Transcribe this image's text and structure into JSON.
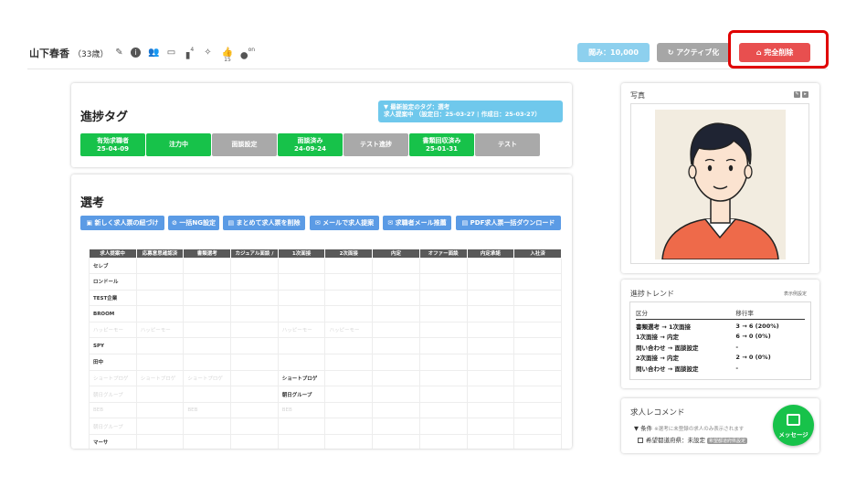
{
  "header": {
    "name": "山下春香",
    "age": "（33歳）",
    "icon_counts": {
      "doc": "4",
      "like": "15",
      "person": "on"
    },
    "view_button": "閲み：10,000",
    "active_button": "アクティブ化",
    "delete_button": "完全削除"
  },
  "progress_tags": {
    "title": "進捗タグ",
    "info_line1": "最新設定のタグ：選考",
    "info_line2": "求人提案中 （設定日：25-03-27 | 作成日：25-03-27）",
    "tags": [
      {
        "label": "有効求職者",
        "date": "25-04-09",
        "color": "green"
      },
      {
        "label": "注力中",
        "date": "",
        "color": "green"
      },
      {
        "label": "面談設定",
        "date": "",
        "color": "gray"
      },
      {
        "label": "面談済み",
        "date": "24-09-24",
        "color": "green"
      },
      {
        "label": "テスト進捗",
        "date": "",
        "color": "gray"
      },
      {
        "label": "書類回収済み",
        "date": "25-01-31",
        "color": "green"
      },
      {
        "label": "テスト",
        "date": "",
        "color": "gray"
      }
    ]
  },
  "selection": {
    "title": "選考",
    "actions": [
      "新しく求人票の紐づけ",
      "一括NG設定",
      "まとめて求人票を削除",
      "メールで求人提案",
      "求職者メール推薦",
      "PDF求人票一括ダウンロード"
    ],
    "columns": [
      "求人提案中",
      "応募意思確認済",
      "書類選考",
      "カジュアル面談 /",
      "1次面接",
      "2次面接",
      "内定",
      "オファー面談",
      "内定承諾",
      "入社済"
    ],
    "rows": [
      {
        "cells": [
          "セレブ",
          "",
          "",
          "",
          "",
          "",
          "",
          "",
          "",
          ""
        ],
        "faint": false
      },
      {
        "cells": [
          "ロンドール",
          "",
          "",
          "",
          "",
          "",
          "",
          "",
          "",
          ""
        ],
        "faint": false
      },
      {
        "cells": [
          "TEST企業",
          "",
          "",
          "",
          "",
          "",
          "",
          "",
          "",
          ""
        ],
        "faint": false
      },
      {
        "cells": [
          "BROOM",
          "",
          "",
          "",
          "",
          "",
          "",
          "",
          "",
          ""
        ],
        "faint": false
      },
      {
        "cells": [
          "ハッピーモー",
          "ハッピーモー",
          "",
          "",
          "ハッピーモー",
          "ハッピーモー",
          "",
          "",
          "",
          ""
        ],
        "faint": true
      },
      {
        "cells": [
          "SPY",
          "",
          "",
          "",
          "",
          "",
          "",
          "",
          "",
          ""
        ],
        "faint": false
      },
      {
        "cells": [
          "田中",
          "",
          "",
          "",
          "",
          "",
          "",
          "",
          "",
          ""
        ],
        "faint": false
      },
      {
        "cells": [
          "ショートプロゲ",
          "ショートプロゲ",
          "ショートプロゲ",
          "",
          "ショートプロゲ",
          "",
          "",
          "",
          "",
          ""
        ],
        "faint": true,
        "bold_col": 4
      },
      {
        "cells": [
          "朝日グループ",
          "",
          "",
          "",
          "朝日グループ",
          "",
          "",
          "",
          "",
          ""
        ],
        "faint": true,
        "bold_col": 4
      },
      {
        "cells": [
          "BEB",
          "",
          "BEB",
          "",
          "BEB",
          "",
          "",
          "",
          "",
          ""
        ],
        "faint": true
      },
      {
        "cells": [
          "朝日グループ",
          "",
          "",
          "",
          "",
          "",
          "",
          "",
          "",
          ""
        ],
        "faint": true
      },
      {
        "cells": [
          "マーサ",
          "",
          "",
          "",
          "",
          "",
          "",
          "",
          "",
          ""
        ],
        "faint": false
      }
    ]
  },
  "photo": {
    "title": "写真"
  },
  "trend": {
    "title": "進捗トレンド",
    "subtitle": "表示例設定",
    "headers": [
      "区分",
      "移行率"
    ],
    "rows": [
      [
        "書類選考 → 1次面接",
        "3 → 6 (200%)"
      ],
      [
        "1次面接 → 内定",
        "6 → 0 (0%)"
      ],
      [
        "問い合わせ → 面談設定",
        "-"
      ],
      [
        "2次面接 → 内定",
        "2 → 0 (0%)"
      ],
      [
        "問い合わせ → 面談設定",
        "-"
      ]
    ]
  },
  "recommend": {
    "title": "求人レコメンド",
    "condition": "▼ 条件",
    "condition_note": "※選考に未登録の求人のみ表示されます",
    "row_label": "希望都道府県：",
    "row_value": "未設定",
    "row_chip": "希望都道府県設定"
  },
  "message_button": "メッセージ",
  "colors": {
    "green": "#17c24a",
    "gray": "#a9a9a9",
    "blue": "#5b9be5",
    "red": "#e84f4f",
    "highlight": "#e00000"
  }
}
